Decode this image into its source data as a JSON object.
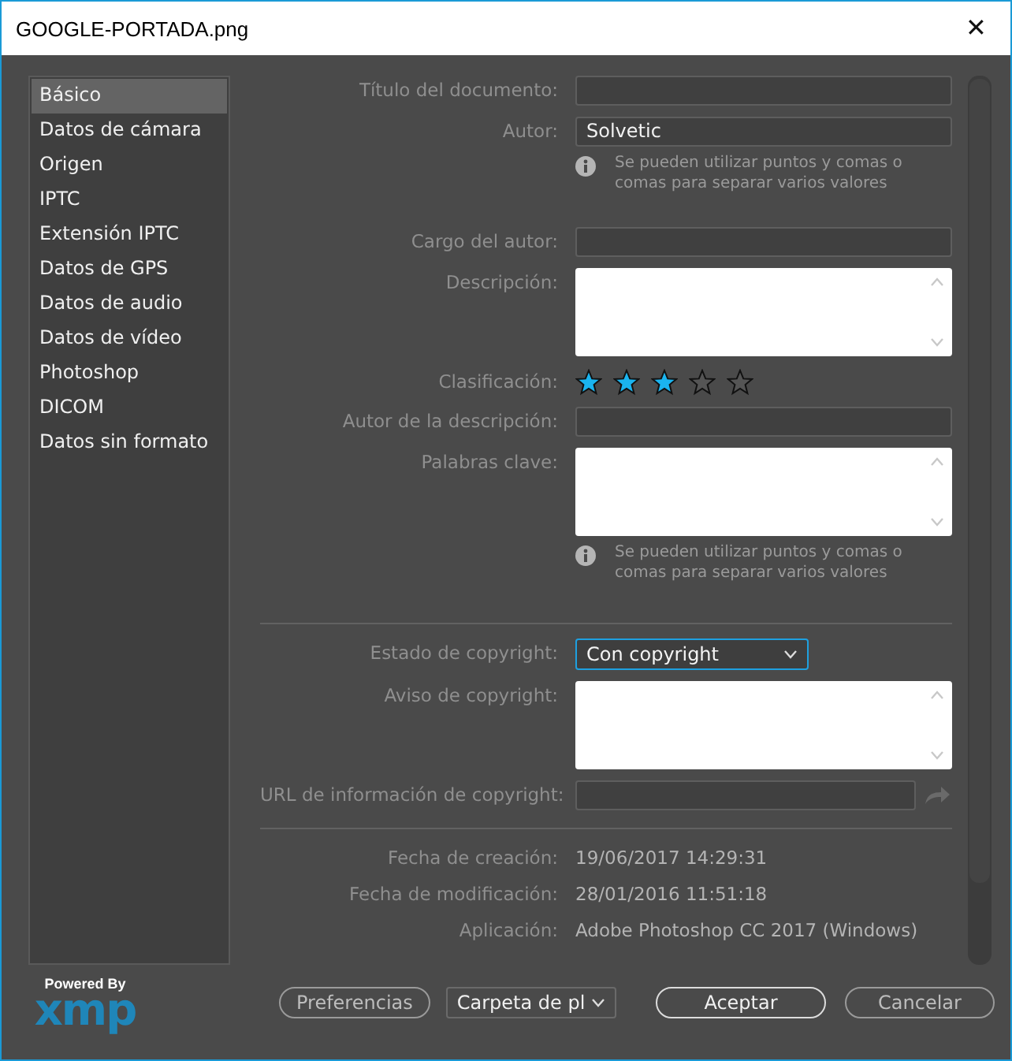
{
  "window": {
    "title": "GOOGLE-PORTADA.png",
    "close": "✕"
  },
  "sidebar": {
    "items": [
      {
        "label": "Básico",
        "selected": true
      },
      {
        "label": "Datos de cámara",
        "selected": false
      },
      {
        "label": "Origen",
        "selected": false
      },
      {
        "label": "IPTC",
        "selected": false
      },
      {
        "label": "Extensión IPTC",
        "selected": false
      },
      {
        "label": "Datos de GPS",
        "selected": false
      },
      {
        "label": "Datos de audio",
        "selected": false
      },
      {
        "label": "Datos de vídeo",
        "selected": false
      },
      {
        "label": "Photoshop",
        "selected": false
      },
      {
        "label": "DICOM",
        "selected": false
      },
      {
        "label": "Datos sin formato",
        "selected": false
      }
    ]
  },
  "form": [
    {
      "kind": "text",
      "label": "Título del documento:"
    },
    {
      "kind": "text",
      "label": "Autor:",
      "value": "Solvetic"
    },
    {
      "kind": "note",
      "text": "Se pueden utilizar puntos y comas o comas para separar varios valores"
    },
    {
      "kind": "text",
      "label": "Cargo del autor:"
    },
    {
      "kind": "textarea",
      "label": "Descripción:"
    },
    {
      "kind": "stars",
      "label": "Clasificación:",
      "stars": 3
    },
    {
      "kind": "text",
      "label": "Autor de la descripción:"
    },
    {
      "kind": "textarea",
      "label": "Palabras clave:"
    },
    {
      "kind": "note",
      "text": "Se pueden utilizar puntos y comas o comas para separar varios valores"
    },
    {
      "kind": "divider"
    },
    {
      "kind": "select",
      "label": "Estado de copyright:",
      "value": "Con copyright"
    },
    {
      "kind": "textarea",
      "label": "Aviso de copyright:"
    },
    {
      "kind": "url",
      "label": "URL de información de copyright:"
    },
    {
      "kind": "divider"
    },
    {
      "kind": "info",
      "label": "Fecha de creación:",
      "value": "19/06/2017 14:29:31"
    },
    {
      "kind": "info",
      "label": "Fecha de modificación:",
      "value": "28/01/2016 11:51:18"
    },
    {
      "kind": "info",
      "label": "Aplicación:",
      "value": "Adobe Photoshop CC 2017 (Windows)"
    }
  ],
  "logo": {
    "caption": "Powered By",
    "mark": "xmp"
  },
  "buttons": {
    "preferences": "Preferencias",
    "folder": "Carpeta de pl",
    "accept": "Aceptar",
    "cancel": "Cancelar"
  }
}
